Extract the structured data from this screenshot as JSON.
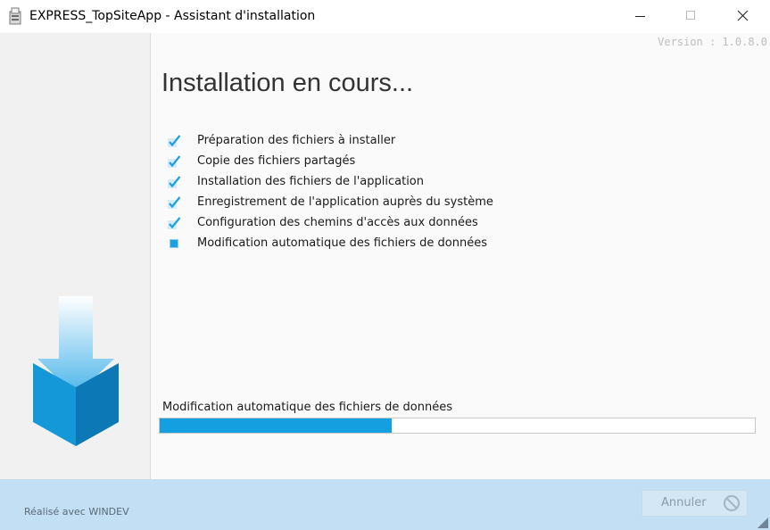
{
  "window": {
    "title": "EXPRESS_TopSiteApp - Assistant d'installation",
    "app_icon": "installer-app-icon",
    "controls": [
      "minimize-icon",
      "maximize-icon",
      "close-icon"
    ]
  },
  "main": {
    "version": "Version : 1.0.8.0",
    "heading": "Installation en cours...",
    "steps": [
      {
        "label": "Préparation des fichiers à installer",
        "state": "done"
      },
      {
        "label": "Copie des fichiers partagés",
        "state": "done"
      },
      {
        "label": "Installation des fichiers de l'application",
        "state": "done"
      },
      {
        "label": "Enregistrement de l'application auprès du système",
        "state": "done"
      },
      {
        "label": "Configuration des chemins d'accès aux données",
        "state": "done"
      },
      {
        "label": "Modification automatique des fichiers de données",
        "state": "in-progress"
      }
    ],
    "progress": {
      "label": "Modification automatique des fichiers de données",
      "fraction": 0.39
    }
  },
  "footer": {
    "made_with": "Réalisé avec WINDEV",
    "cancel_label": "Annuler",
    "cancel_icon": "no-entry-icon"
  },
  "colors": {
    "accent": "#149fe0",
    "footer_bg": "#c2dff3",
    "check": "#1ea0e0"
  }
}
